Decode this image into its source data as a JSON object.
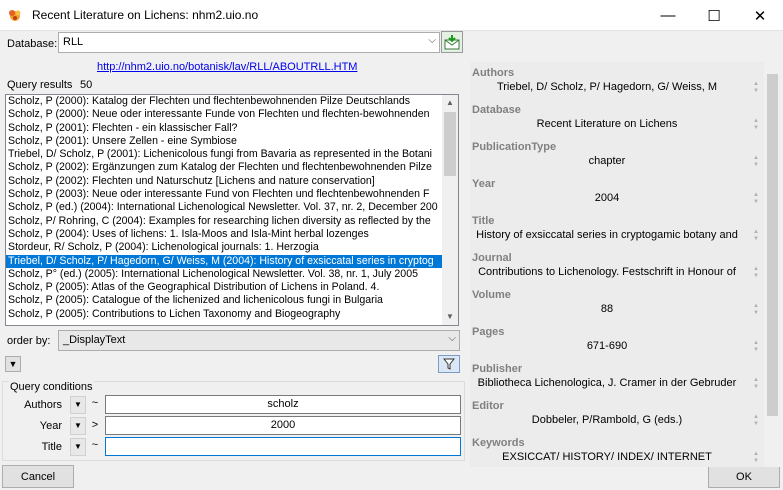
{
  "window": {
    "title": "Recent Literature on Lichens: nhm2.uio.no",
    "minimize_glyph": "—",
    "maximize_glyph": "☐",
    "close_glyph": "✕"
  },
  "database": {
    "label": "Database:",
    "value": "RLL",
    "link": "http://nhm2.uio.no/botanisk/lav/RLL/ABOUTRLL.HTM"
  },
  "results": {
    "label": "Query results",
    "count": "50",
    "items": [
      "Scholz, P (2000): Katalog der Flechten und flechtenbewohnenden Pilze Deutschlands",
      "Scholz, P (2000): Neue oder interessante Funde von Flechten und flechten-bewohnenden",
      "Scholz, P (2001): Flechten - ein klassischer Fall?",
      "Scholz, P (2001): Unsere Zellen - eine Symbiose",
      "Triebel, D/ Scholz, P (2001): Lichenicolous fungi from Bavaria as represented in the Botani",
      "Scholz, P (2002): Ergänzungen zum Katalog der Flechten und flechtenbewohnenden Pilze",
      "Scholz, P (2002): Flechten und Naturschutz [Lichens and nature conservation]",
      "Scholz, P (2003): Neue oder interessante Fund von Flechten und flechtenbewohnenden F",
      "Scholz, P (ed.) (2004): International Lichenological Newsletter. Vol. 37, nr. 2, December 200",
      "Scholz, P/ Rohring, C (2004): Examples for researching lichen diversity as reflected by the",
      "Scholz, P (2004): Uses of lichens: 1. Isla-Moos and Isla-Mint herbal lozenges",
      "Stordeur, R/ Scholz, P (2004): Lichenological journals: 1. Herzogia",
      "Triebel, D/ Scholz, P/ Hagedorn, G/ Weiss, M (2004): History of exsiccatal series in cryptog",
      "Scholz, P° (ed.) (2005): International Lichenological Newsletter. Vol. 38, nr. 1, July 2005",
      "Scholz, P (2005): Atlas of the Geographical Distribution of Lichens in Poland. 4.",
      "Scholz, P (2005): Catalogue of the lichenized and lichenicolous fungi in Bulgaria",
      "Scholz, P (2005): Contributions to Lichen Taxonomy and Biogeography"
    ],
    "selected_index": 12
  },
  "order_by": {
    "label": "order by:",
    "value": "_DisplayText"
  },
  "conditions": {
    "title": "Query conditions",
    "rows": [
      {
        "label": "Authors",
        "op": "~",
        "value": "scholz"
      },
      {
        "label": "Year",
        "op": ">",
        "value": "2000"
      },
      {
        "label": "Title",
        "op": "~",
        "value": ""
      }
    ]
  },
  "buttons": {
    "cancel": "Cancel",
    "ok": "OK"
  },
  "details": [
    {
      "label": "Authors",
      "value": "Triebel, D/ Scholz, P/ Hagedorn, G/ Weiss, M"
    },
    {
      "label": "Database",
      "value": "Recent Literature on Lichens"
    },
    {
      "label": "PublicationType",
      "value": "chapter"
    },
    {
      "label": "Year",
      "value": "2004"
    },
    {
      "label": "Title",
      "value": "History of exsiccatal series in cryptogamic botany and"
    },
    {
      "label": "Journal",
      "value": "Contributions to Lichenology. Festschrift in Honour of"
    },
    {
      "label": "Volume",
      "value": "88"
    },
    {
      "label": "Pages",
      "value": "671-690"
    },
    {
      "label": "Publisher",
      "value": "Bibliotheca Lichenologica, J. Cramer in der Gebruder"
    },
    {
      "label": "Editor",
      "value": "Dobbeler, P/Rambold, G (eds.)"
    },
    {
      "label": "Keywords",
      "value": "EXSICCAT/ HISTORY/ INDEX/ INTERNET"
    }
  ],
  "colors": {
    "selection": "#0078d7",
    "link": "#0000ee",
    "label_gray": "#808080"
  }
}
